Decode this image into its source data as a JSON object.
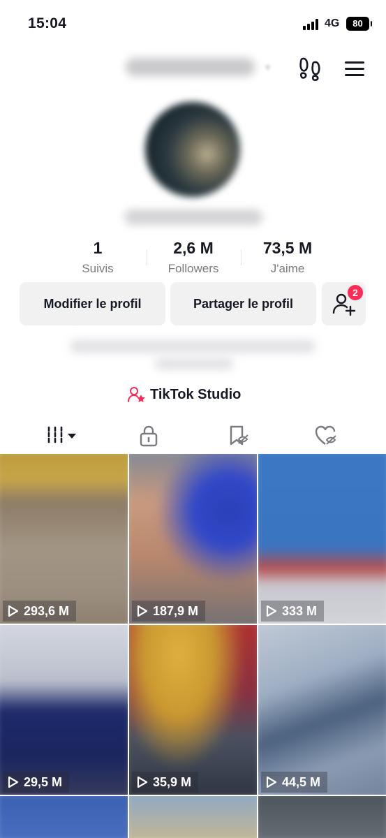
{
  "status_bar": {
    "time": "15:04",
    "network": "4G",
    "battery": "80"
  },
  "header": {
    "footprints_icon": "footprints-icon",
    "menu_icon": "hamburger-menu-icon"
  },
  "stats": [
    {
      "value": "1",
      "label": "Suivis"
    },
    {
      "value": "2,6 M",
      "label": "Followers"
    },
    {
      "value": "73,5 M",
      "label": "J'aime"
    }
  ],
  "actions": {
    "edit_profile": "Modifier le profil",
    "share_profile": "Partager le profil",
    "add_friend_badge": "2"
  },
  "studio": {
    "label": "TikTok Studio",
    "accent": "#fe2c55"
  },
  "tabs": [
    {
      "icon": "videos-grid-icon",
      "selected": true
    },
    {
      "icon": "lock-icon",
      "selected": false
    },
    {
      "icon": "favorites-icon",
      "selected": false
    },
    {
      "icon": "liked-icon",
      "selected": false
    }
  ],
  "videos": [
    {
      "views": "293,6 M"
    },
    {
      "views": "187,9 M"
    },
    {
      "views": "333 M"
    },
    {
      "views": "29,5 M"
    },
    {
      "views": "35,9 M"
    },
    {
      "views": "44,5 M"
    }
  ],
  "colors": {
    "text": "#161823",
    "secondary": "#7a7b80",
    "button_bg": "#f1f1f2",
    "accent": "#fe2c55"
  }
}
